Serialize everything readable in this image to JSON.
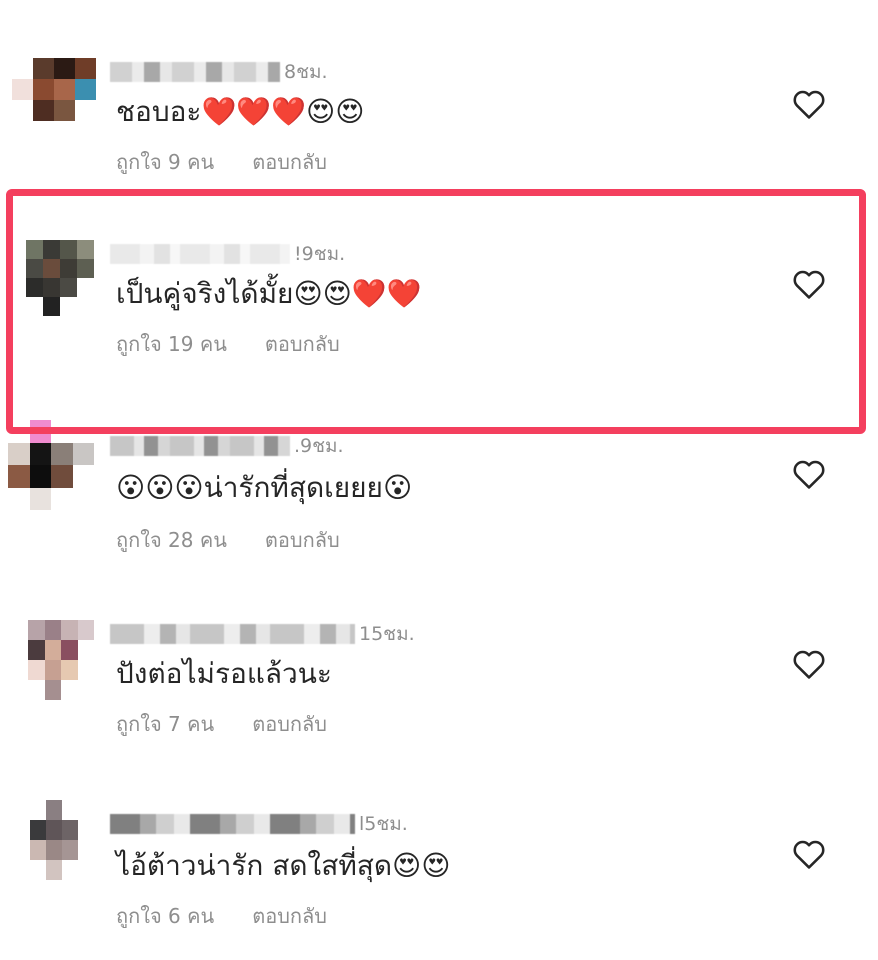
{
  "comments": [
    {
      "user_suffix": "8ชม.",
      "text": "ชอบอะ❤️❤️❤️😍😍",
      "likes": "ถูกใจ 9 คน",
      "reply": "ตอบกลับ"
    },
    {
      "user_suffix": "!9ชม.",
      "text": "เป็นคู่จริงได้มั้ย😍😍❤️❤️",
      "likes": "ถูกใจ 19 คน",
      "reply": "ตอบกลับ"
    },
    {
      "user_suffix": ".9ชม.",
      "text": "😮😮😮น่ารักที่สุดเยยย😮",
      "likes": "ถูกใจ 28 คน",
      "reply": "ตอบกลับ"
    },
    {
      "user_suffix": "15ชม.",
      "text": "ปังต่อไม่รอแล้วนะ",
      "likes": "ถูกใจ 7 คน",
      "reply": "ตอบกลับ"
    },
    {
      "user_suffix": "l5ชม.",
      "text": "ไอ้ต้าวน่ารัก สดใสที่สุด😍😍",
      "likes": "ถูกใจ 6 คน",
      "reply": "ตอบกลับ"
    }
  ],
  "colors": {
    "highlight": "#f43f5e",
    "meta": "#8e8e8e",
    "text": "#262626"
  },
  "icons": {
    "like": "heart-outline-icon"
  }
}
